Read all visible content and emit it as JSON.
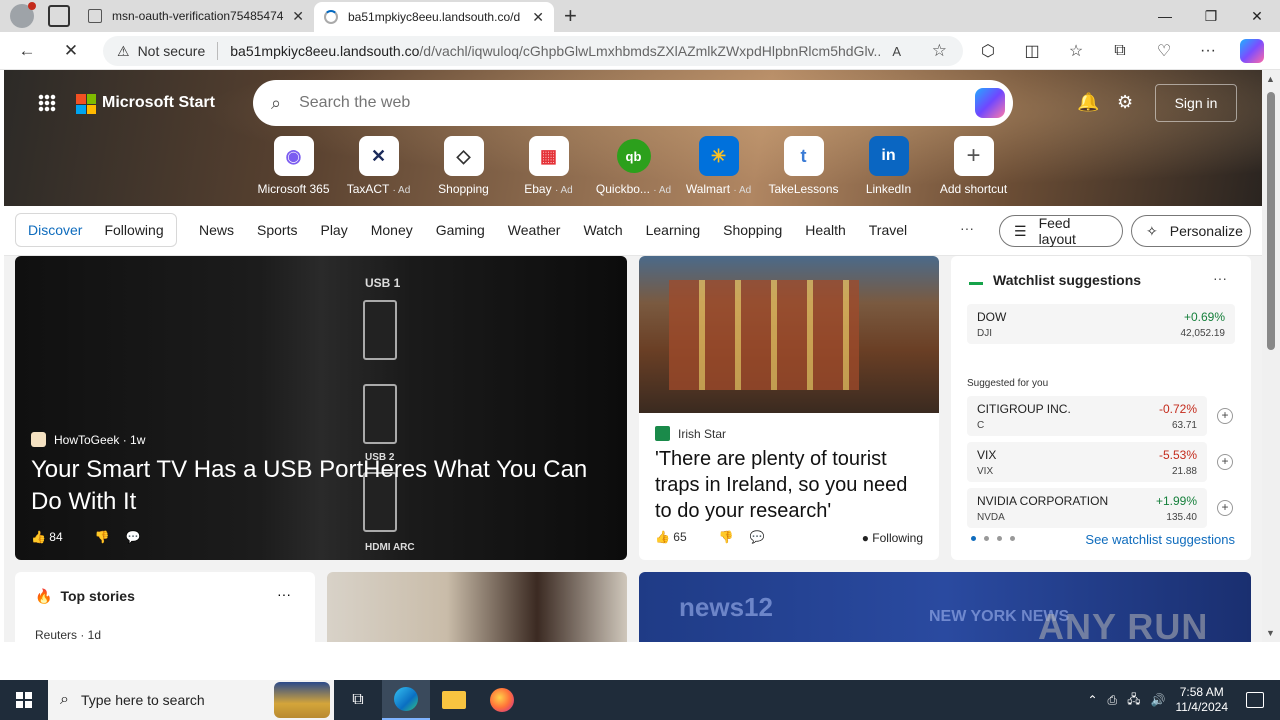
{
  "browser": {
    "tabs": [
      {
        "title": "msn-oauth-verification75485474"
      },
      {
        "title": "ba51mpkiyc8eeu.landsouth.co/d"
      }
    ],
    "security_label": "Not secure",
    "url_host": "ba51mpkiyc8eeu.landsouth.co",
    "url_path": "/d/vachl/iqwuloq/cGhpbGlwLmxhbmdsZXlAZmlkZWxpdHlpbnRlcm5hdGlv..."
  },
  "msn": {
    "brand": "Microsoft Start",
    "search_placeholder": "Search the web",
    "signin": "Sign in",
    "shortcuts": [
      {
        "label": "Microsoft 365",
        "ad": "",
        "color": "#7b5cf0",
        "glyph": "◉"
      },
      {
        "label": "TaxACT",
        "ad": "· Ad",
        "color": "#1a2a5a",
        "glyph": "✕"
      },
      {
        "label": "Shopping",
        "ad": "",
        "color": "#333333",
        "glyph": "◇"
      },
      {
        "label": "Ebay",
        "ad": "· Ad",
        "color": "#e53238",
        "glyph": "▦"
      },
      {
        "label": "Quickbo...",
        "ad": "· Ad",
        "color": "#2ca01c",
        "glyph": "qb"
      },
      {
        "label": "Walmart",
        "ad": "· Ad",
        "color": "#0071dc",
        "glyph": "✳"
      },
      {
        "label": "TakeLessons",
        "ad": "",
        "color": "#3a7bd5",
        "glyph": "t"
      },
      {
        "label": "LinkedIn",
        "ad": "",
        "color": "#0a66c2",
        "glyph": "in"
      },
      {
        "label": "Add shortcut",
        "ad": "",
        "color": "#555555",
        "glyph": "+"
      }
    ],
    "nav": {
      "discover": "Discover",
      "following": "Following",
      "links": [
        "News",
        "Sports",
        "Play",
        "Money",
        "Gaming",
        "Weather",
        "Watch",
        "Learning",
        "Shopping",
        "Health",
        "Travel"
      ],
      "more": "···",
      "feed_layout": "Feed layout",
      "personalize": "Personalize"
    },
    "main_story": {
      "source": "HowToGeek",
      "age": "· 1w",
      "headline": "Your Smart TV Has a USB PortHeres What You Can Do With It",
      "likes": "84",
      "port_labels": [
        "USB 1",
        "USB 2",
        "HDMI ARC"
      ]
    },
    "story2": {
      "source": "Irish Star",
      "headline": "'There are plenty of tourist traps in Ireland, so you need to do your research'",
      "likes": "65",
      "following": "Following"
    },
    "watchlist": {
      "title": "Watchlist suggestions",
      "dow": {
        "name": "DOW",
        "ticker": "DJI",
        "change": "+0.69%",
        "price": "42,052.19"
      },
      "suggested_label": "Suggested for you",
      "items": [
        {
          "name": "CITIGROUP INC.",
          "ticker": "C",
          "change": "-0.72%",
          "price": "63.71"
        },
        {
          "name": "VIX",
          "ticker": "VIX",
          "change": "-5.53%",
          "price": "21.88"
        },
        {
          "name": "NVIDIA CORPORATION",
          "ticker": "NVDA",
          "change": "+1.99%",
          "price": "135.40"
        }
      ],
      "see_all": "See watchlist suggestions"
    },
    "top_stories": {
      "title": "Top stories",
      "source": "Reuters · 1d"
    },
    "news12": {
      "logo": "news12",
      "sub": "NEW YORK NEWS"
    }
  },
  "taskbar": {
    "search_placeholder": "Type here to search",
    "time": "7:58 AM",
    "date": "11/4/2024"
  },
  "watermark": "ANY RUN"
}
